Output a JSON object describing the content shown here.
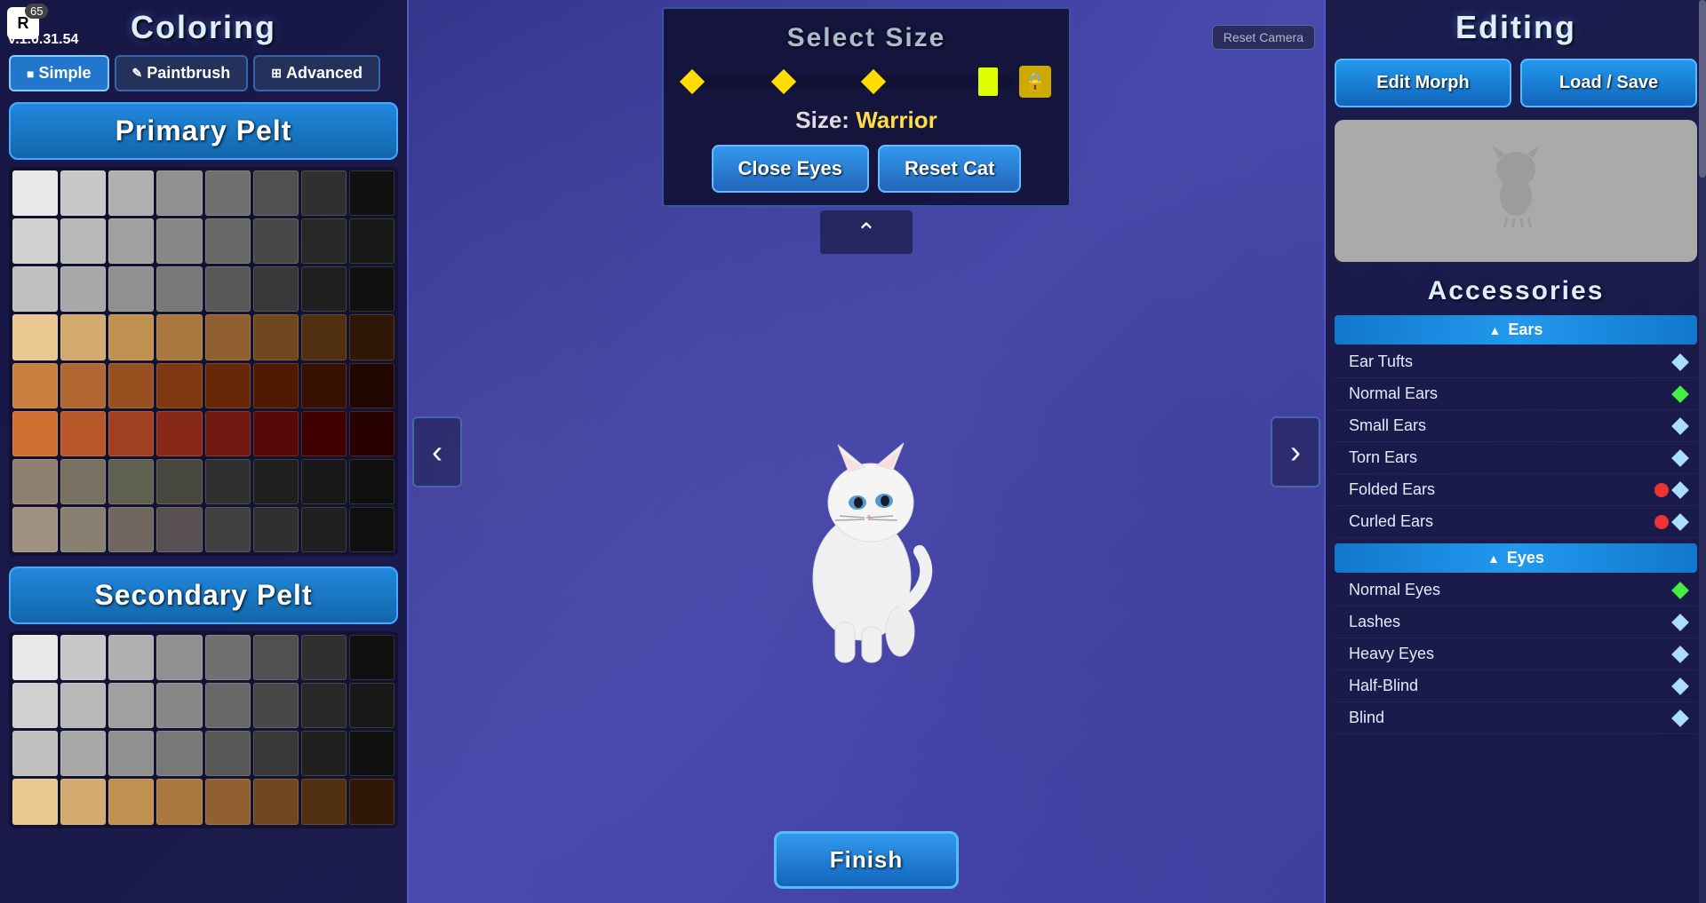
{
  "version": "V.1.0.31.54",
  "roblox": {
    "icon": "R",
    "notification_count": "65"
  },
  "reset_camera": "Reset Camera",
  "left_panel": {
    "title": "Coloring",
    "modes": [
      {
        "id": "simple",
        "label": "Simple",
        "icon": "■",
        "active": true
      },
      {
        "id": "paintbrush",
        "label": "Paintbrush",
        "icon": "✎",
        "active": false
      },
      {
        "id": "advanced",
        "label": "Advanced",
        "icon": "⊞",
        "active": false
      }
    ],
    "primary_pelt": {
      "label": "Primary Pelt"
    },
    "secondary_pelt": {
      "label": "Secondary Pelt"
    }
  },
  "center": {
    "select_size_title": "Select Size",
    "size_label_prefix": "Size:",
    "size_value": "Warrior",
    "close_eyes_btn": "Close Eyes",
    "reset_cat_btn": "Reset Cat",
    "finish_btn": "Finish",
    "chevron_up": "^"
  },
  "right_panel": {
    "title": "Editing",
    "edit_morph_btn": "Edit Morph",
    "load_save_btn": "Load / Save",
    "accessories_title": "Accessories",
    "sections": [
      {
        "name": "Ears",
        "items": [
          {
            "label": "Ear Tufts",
            "diamond": "white",
            "locked": false
          },
          {
            "label": "Normal Ears",
            "diamond": "green",
            "locked": false
          },
          {
            "label": "Small Ears",
            "diamond": "white",
            "locked": false
          },
          {
            "label": "Torn Ears",
            "diamond": "white",
            "locked": false
          },
          {
            "label": "Folded Ears",
            "diamond": "white",
            "locked": true
          },
          {
            "label": "Curled Ears",
            "diamond": "white",
            "locked": true
          }
        ]
      },
      {
        "name": "Eyes",
        "items": [
          {
            "label": "Normal Eyes",
            "diamond": "green",
            "locked": false
          },
          {
            "label": "Lashes",
            "diamond": "white",
            "locked": false
          },
          {
            "label": "Heavy Eyes",
            "diamond": "white",
            "locked": false
          },
          {
            "label": "Half-Blind",
            "diamond": "white",
            "locked": false
          },
          {
            "label": "Blind",
            "diamond": "white",
            "locked": false
          }
        ]
      }
    ]
  },
  "primary_colors": [
    "#e8e8e8",
    "#c8c8c8",
    "#b0b0b0",
    "#909090",
    "#707070",
    "#505050",
    "#303030",
    "#111111",
    "#d0d0d0",
    "#b8b8b8",
    "#a0a0a0",
    "#888888",
    "#686868",
    "#484848",
    "#282828",
    "#181818",
    "#c0c0c0",
    "#a8a8a8",
    "#909090",
    "#787878",
    "#585858",
    "#383838",
    "#202020",
    "#101010",
    "#e8c890",
    "#d4aa70",
    "#c09050",
    "#a87840",
    "#906030",
    "#704820",
    "#503010",
    "#301808",
    "#c88040",
    "#b06830",
    "#985020",
    "#803810",
    "#682808",
    "#501800",
    "#381000",
    "#200800",
    "#d07030",
    "#b85828",
    "#a04020",
    "#882818",
    "#701810",
    "#580808",
    "#400000",
    "#280000",
    "#908070",
    "#787060",
    "#606050",
    "#484840",
    "#303030",
    "#202020",
    "#181818",
    "#101010",
    "#a09080",
    "#888070",
    "#706860",
    "#585050",
    "#404040",
    "#303030",
    "#202020",
    "#101010"
  ],
  "secondary_colors": [
    "#e8e8e8",
    "#c8c8c8",
    "#b0b0b0",
    "#909090",
    "#707070",
    "#505050",
    "#303030",
    "#111111",
    "#d0d0d0",
    "#b8b8b8",
    "#a0a0a0",
    "#888888",
    "#686868",
    "#484848",
    "#282828",
    "#181818",
    "#c0c0c0",
    "#a8a8a8",
    "#909090",
    "#787878",
    "#585858",
    "#383838",
    "#202020",
    "#101010",
    "#e8c890",
    "#d4aa70",
    "#c09050",
    "#a87840",
    "#906030",
    "#704820",
    "#503010",
    "#301808"
  ]
}
